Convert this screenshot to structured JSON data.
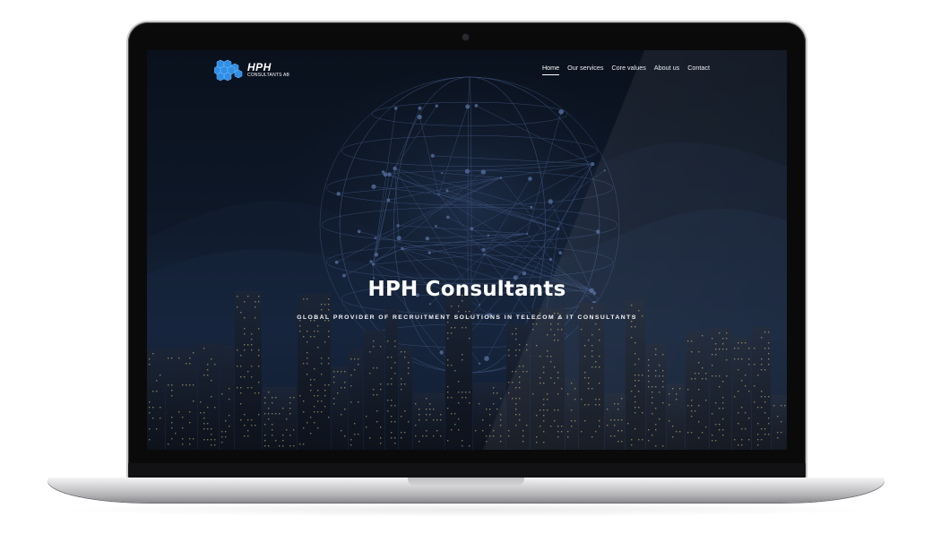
{
  "logo": {
    "name": "HPH",
    "subtitle": "CONSULTANTS AB"
  },
  "nav": {
    "items": [
      {
        "label": "Home",
        "active": true
      },
      {
        "label": "Our services",
        "active": false
      },
      {
        "label": "Core values",
        "active": false
      },
      {
        "label": "About us",
        "active": false
      },
      {
        "label": "Contact",
        "active": false
      }
    ]
  },
  "hero": {
    "title": "HPH Consultants",
    "subtitle": "GLOBAL PROVIDER OF RECRUITMENT SOLUTIONS IN TELECOM & IT CONSULTANTS"
  },
  "colors": {
    "logo_blue": "#2f8ee6",
    "background_dark": "#0e1828",
    "text": "#ffffff"
  },
  "icons": {
    "logo": "hexagon-cluster-icon",
    "background": "network-globe-graphic"
  }
}
